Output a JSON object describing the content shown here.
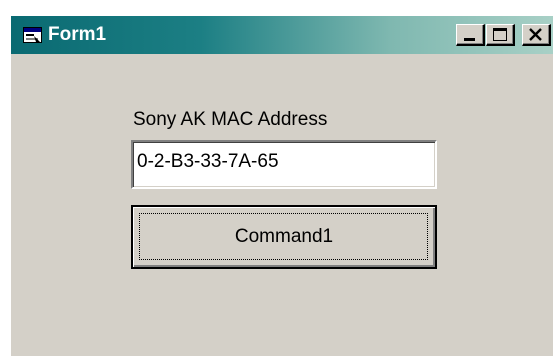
{
  "window": {
    "title": "Form1",
    "icon": "form-window-icon",
    "controls": {
      "minimize_icon": "minimize-icon",
      "maximize_icon": "maximize-icon",
      "close_icon": "close-icon"
    },
    "colors": {
      "titlebar_start": "#0a6a72",
      "titlebar_end": "#a8d0c6",
      "face": "#d4d0c8"
    }
  },
  "form": {
    "mac_label": "Sony AK MAC Address",
    "mac_value": "0-2-B3-33-7A-65",
    "command_label": "Command1"
  }
}
